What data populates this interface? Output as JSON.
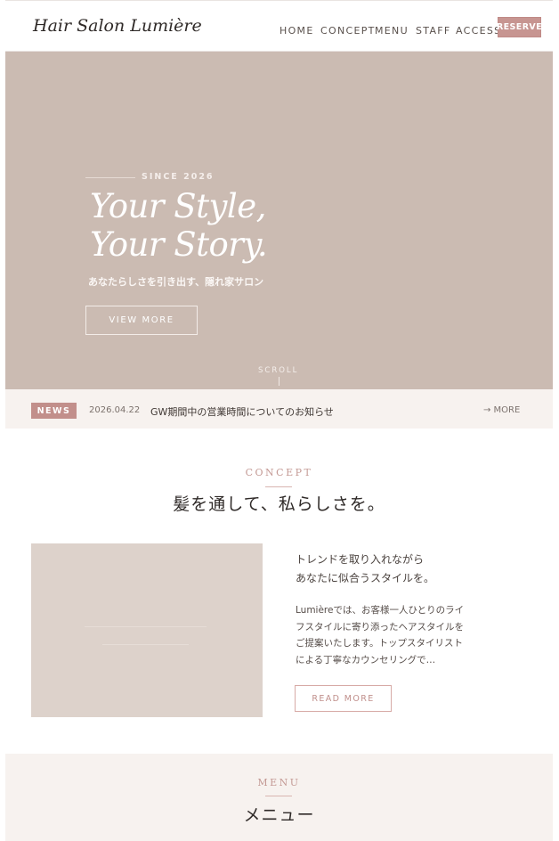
{
  "header": {
    "logo": "Hair Salon Lumière",
    "nav": [
      "HOME",
      "CONCEPT",
      "MENU",
      "STAFF",
      "ACCESS"
    ],
    "reserve_label": "RESERVE"
  },
  "hero": {
    "since": "SINCE 2026",
    "headline_line1": "Your Style,",
    "headline_line2": "Your Story.",
    "tagline": "あなたらしさを引き出す、隠れ家サロン",
    "view_more": "VIEW MORE",
    "scroll": "SCROLL"
  },
  "news": {
    "badge": "NEWS",
    "date": "2026.04.22",
    "title": "GW期間中の営業時間についてのお知らせ",
    "more": "→ MORE"
  },
  "concept": {
    "label": "CONCEPT",
    "title": "髪を通して、私らしさを。",
    "lead_line1": "トレンドを取り入れながら",
    "lead_line2": "あなたに似合うスタイルを。",
    "body_lines": [
      "Lumièreでは、お客様一人ひとりのライ",
      "フスタイルに寄り添ったヘアスタイルを",
      "ご提案いたします。トップスタイリスト",
      "による丁寧なカウンセリングで…"
    ],
    "read_more": "READ MORE"
  },
  "menu": {
    "label": "MENU",
    "title": "メニュー"
  },
  "colors": {
    "accent": "#c79591",
    "hero_bg": "#cbbbb2",
    "section_bg": "#f7f2ef"
  }
}
